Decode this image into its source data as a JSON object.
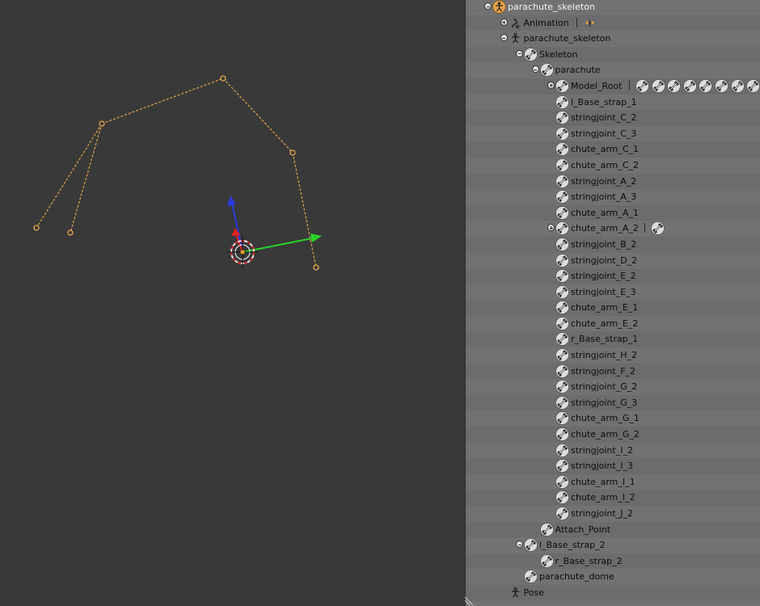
{
  "viewport": {
    "colors": {
      "background": "#393939",
      "bone": "#e6a64a",
      "x_axis": "#e02020",
      "y_axis": "#28d428",
      "z_axis": "#2a3ae0"
    }
  },
  "outliner": {
    "colors": {
      "background": "#727272",
      "row_alt": "#6c6c6c",
      "text": "#0c0c0c",
      "selected_text": "#f4f4f4",
      "icon_bg": "#dcdcdc"
    },
    "rows": [
      {
        "label": "parachute_skeleton",
        "indent": 0,
        "expander": "minus",
        "icon": "armature-object-icon",
        "selected": true
      },
      {
        "label": "Animation",
        "indent": 1,
        "expander": "plus",
        "icon": "animation-icon",
        "extras": [
          "action-icon"
        ]
      },
      {
        "label": "parachute_skeleton",
        "indent": 1,
        "expander": "minus",
        "icon": "armature-data-icon"
      },
      {
        "label": "Skeleton",
        "indent": 2,
        "expander": "minus",
        "icon": "bone-icon"
      },
      {
        "label": "parachute",
        "indent": 3,
        "expander": "minus",
        "icon": "bone-icon"
      },
      {
        "label": "Model_Root",
        "indent": 4,
        "expander": "plus",
        "icon": "bone-icon",
        "extras": [
          "bone-icon",
          "bone-icon",
          "bone-icon",
          "bone-icon",
          "bone-icon",
          "bone-icon",
          "bone-icon",
          "bone-icon"
        ]
      },
      {
        "label": "l_Base_strap_1",
        "indent": 4,
        "icon": "bone-icon"
      },
      {
        "label": "stringjoint_C_2",
        "indent": 4,
        "icon": "bone-icon"
      },
      {
        "label": "stringjoint_C_3",
        "indent": 4,
        "icon": "bone-icon"
      },
      {
        "label": "chute_arm_C_1",
        "indent": 4,
        "icon": "bone-icon"
      },
      {
        "label": "chute_arm_C_2",
        "indent": 4,
        "icon": "bone-icon"
      },
      {
        "label": "stringjoint_A_2",
        "indent": 4,
        "icon": "bone-icon"
      },
      {
        "label": "stringjoint_A_3",
        "indent": 4,
        "icon": "bone-icon"
      },
      {
        "label": "chute_arm_A_1",
        "indent": 4,
        "icon": "bone-icon"
      },
      {
        "label": "chute_arm_A_2",
        "indent": 4,
        "expander": "plus",
        "icon": "bone-icon",
        "extras": [
          "bone-icon"
        ]
      },
      {
        "label": "stringjoint_B_2",
        "indent": 4,
        "icon": "bone-icon"
      },
      {
        "label": "stringjoint_D_2",
        "indent": 4,
        "icon": "bone-icon"
      },
      {
        "label": "stringjoint_E_2",
        "indent": 4,
        "icon": "bone-icon"
      },
      {
        "label": "stringjoint_E_3",
        "indent": 4,
        "icon": "bone-icon"
      },
      {
        "label": "chute_arm_E_1",
        "indent": 4,
        "icon": "bone-icon"
      },
      {
        "label": "chute_arm_E_2",
        "indent": 4,
        "icon": "bone-icon"
      },
      {
        "label": "r_Base_strap_1",
        "indent": 4,
        "icon": "bone-icon"
      },
      {
        "label": "stringjoint_H_2",
        "indent": 4,
        "icon": "bone-icon"
      },
      {
        "label": "stringjoint_F_2",
        "indent": 4,
        "icon": "bone-icon"
      },
      {
        "label": "stringjoint_G_2",
        "indent": 4,
        "icon": "bone-icon"
      },
      {
        "label": "stringjoint_G_3",
        "indent": 4,
        "icon": "bone-icon"
      },
      {
        "label": "chute_arm_G_1",
        "indent": 4,
        "icon": "bone-icon"
      },
      {
        "label": "chute_arm_G_2",
        "indent": 4,
        "icon": "bone-icon"
      },
      {
        "label": "stringjoint_I_2",
        "indent": 4,
        "icon": "bone-icon"
      },
      {
        "label": "stringjoint_I_3",
        "indent": 4,
        "icon": "bone-icon"
      },
      {
        "label": "chute_arm_I_1",
        "indent": 4,
        "icon": "bone-icon"
      },
      {
        "label": "chute_arm_I_2",
        "indent": 4,
        "icon": "bone-icon"
      },
      {
        "label": "stringjoint_J_2",
        "indent": 4,
        "icon": "bone-icon"
      },
      {
        "label": "Attach_Point",
        "indent": 3,
        "icon": "bone-icon"
      },
      {
        "label": "l_Base_strap_2",
        "indent": 2,
        "expander": "minus",
        "icon": "bone-icon"
      },
      {
        "label": "r_Base_strap_2",
        "indent": 3,
        "icon": "bone-icon"
      },
      {
        "label": "parachute_dome",
        "indent": 2,
        "icon": "bone-icon"
      },
      {
        "label": "Pose",
        "indent": 1,
        "icon": "pose-icon"
      }
    ]
  }
}
